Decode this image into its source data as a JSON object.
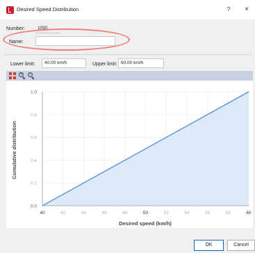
{
  "window": {
    "title": "Desired Speed Distribution",
    "help_label": "?",
    "close_label": "×"
  },
  "form": {
    "number_label": "Number:",
    "number_value": "1050",
    "name_label": "Name:",
    "name_value": "",
    "lower_limit_label": "Lower limit:",
    "lower_limit_value": "40.00 km/h",
    "upper_limit_label": "Upper limit:",
    "upper_limit_value": "60.00 km/h"
  },
  "toolbar": {
    "icons": [
      "zoom-fit-icon",
      "zoom-in-icon",
      "zoom-out-icon"
    ]
  },
  "chart_data": {
    "type": "area",
    "x": [
      40,
      60
    ],
    "y": [
      0.0,
      1.0
    ],
    "xlabel": "Desired speed (km/h)",
    "ylabel": "Cumulative distribution",
    "xlim": [
      40,
      60
    ],
    "ylim": [
      0.0,
      1.0
    ],
    "x_ticks": [
      "40",
      "42",
      "44",
      "46",
      "48",
      "50",
      "52",
      "54",
      "56",
      "58",
      "60"
    ],
    "y_ticks": [
      "0.0",
      "0.2",
      "0.4",
      "0.6",
      "0.8",
      "1.0"
    ],
    "grid": true,
    "line_color": "#5b8fd6",
    "fill_color": "#dce9f7"
  },
  "buttons": {
    "ok_label": "OK",
    "cancel_label": "Cancel"
  },
  "colors": {
    "highlight": "#f07e7e",
    "toolbar": "#c9d1e0",
    "title_icon": "#c8202c"
  }
}
